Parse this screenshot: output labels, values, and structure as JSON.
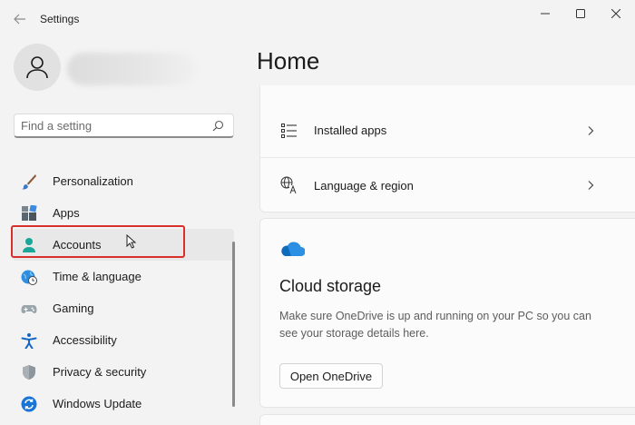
{
  "app": {
    "title": "Settings"
  },
  "titlebar": {
    "back_icon": "back-arrow-icon",
    "minimize_icon": "minimize-icon",
    "maximize_icon": "maximize-icon",
    "close_icon": "close-icon"
  },
  "profile": {
    "avatar_icon": "user-icon",
    "name_redacted": true
  },
  "search": {
    "placeholder": "Find a setting",
    "value": "",
    "icon": "search-icon"
  },
  "nav": {
    "items": [
      {
        "label": "Personalization",
        "icon": "paintbrush-icon",
        "active": false
      },
      {
        "label": "Apps",
        "icon": "apps-icon",
        "active": false
      },
      {
        "label": "Accounts",
        "icon": "accounts-icon",
        "active": true
      },
      {
        "label": "Time & language",
        "icon": "globe-clock-icon",
        "active": false
      },
      {
        "label": "Gaming",
        "icon": "gamepad-icon",
        "active": false
      },
      {
        "label": "Accessibility",
        "icon": "accessibility-icon",
        "active": false
      },
      {
        "label": "Privacy & security",
        "icon": "shield-icon",
        "active": false
      },
      {
        "label": "Windows Update",
        "icon": "update-icon",
        "active": false
      }
    ]
  },
  "main": {
    "title": "Home",
    "rows": [
      {
        "label": "Installed apps",
        "icon": "list-icon"
      },
      {
        "label": "Language & region",
        "icon": "language-icon"
      }
    ],
    "cloud_card": {
      "icon": "onedrive-cloud-icon",
      "title": "Cloud storage",
      "description": "Make sure OneDrive is up and running on your PC so you can see your storage details here.",
      "button_label": "Open OneDrive"
    }
  },
  "colors": {
    "accent": "#0078d4",
    "highlight": "#d9302c",
    "background": "#f3f3f3",
    "card": "#fbfbfb"
  }
}
